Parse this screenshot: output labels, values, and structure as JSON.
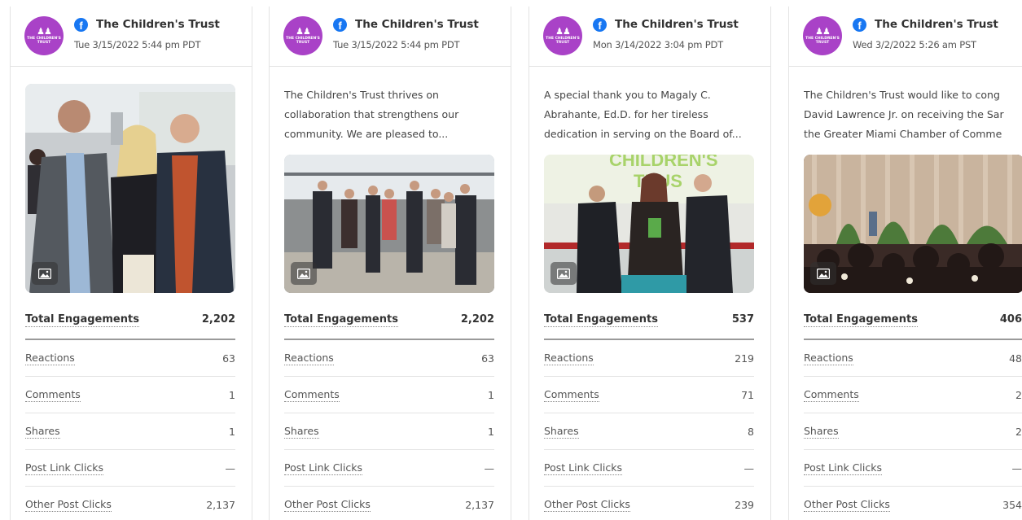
{
  "cards": [
    {
      "page_name": "The Children's Trust",
      "date": "Tue 3/15/2022 5:44 pm PDT",
      "text_lines": [],
      "metrics": {
        "total_label": "Total Engagements",
        "total_value": "2,202",
        "reactions_label": "Reactions",
        "reactions_value": "63",
        "comments_label": "Comments",
        "comments_value": "1",
        "shares_label": "Shares",
        "shares_value": "1",
        "link_clicks_label": "Post Link Clicks",
        "link_clicks_value": "—",
        "other_clicks_label": "Other Post Clicks",
        "other_clicks_value": "2,137"
      }
    },
    {
      "page_name": "The Children's Trust",
      "date": "Tue 3/15/2022 5:44 pm PDT",
      "text_lines": [
        "The Children's Trust thrives on",
        "collaboration that strengthens our",
        "community. We are pleased to..."
      ],
      "metrics": {
        "total_label": "Total Engagements",
        "total_value": "2,202",
        "reactions_label": "Reactions",
        "reactions_value": "63",
        "comments_label": "Comments",
        "comments_value": "1",
        "shares_label": "Shares",
        "shares_value": "1",
        "link_clicks_label": "Post Link Clicks",
        "link_clicks_value": "—",
        "other_clicks_label": "Other Post Clicks",
        "other_clicks_value": "2,137"
      }
    },
    {
      "page_name": "The Children's Trust",
      "date": "Mon 3/14/2022 3:04 pm PDT",
      "text_lines": [
        "A special thank you to Magaly C.",
        "Abrahante, Ed.D. for her tireless",
        "dedication in serving on the Board of..."
      ],
      "metrics": {
        "total_label": "Total Engagements",
        "total_value": "537",
        "reactions_label": "Reactions",
        "reactions_value": "219",
        "comments_label": "Comments",
        "comments_value": "71",
        "shares_label": "Shares",
        "shares_value": "8",
        "link_clicks_label": "Post Link Clicks",
        "link_clicks_value": "—",
        "other_clicks_label": "Other Post Clicks",
        "other_clicks_value": "239"
      }
    },
    {
      "page_name": "The Children's Trust",
      "date": "Wed 3/2/2022 5:26 am PST",
      "text_lines": [
        "The Children's Trust would like to cong",
        "David Lawrence Jr. on receiving the Sar",
        "the Greater Miami Chamber of Comme"
      ],
      "metrics": {
        "total_label": "Total Engagements",
        "total_value": "406",
        "reactions_label": "Reactions",
        "reactions_value": "48",
        "comments_label": "Comments",
        "comments_value": "2",
        "shares_label": "Shares",
        "shares_value": "2",
        "link_clicks_label": "Post Link Clicks",
        "link_clicks_value": "—",
        "other_clicks_label": "Other Post Clicks",
        "other_clicks_value": "354"
      }
    }
  ],
  "avatar": {
    "figures": "ⅢⅢ",
    "logo_text": "THE CHILDREN'S TRUST"
  },
  "colors": {
    "avatar": "#a942c7",
    "facebook": "#1877f2"
  },
  "icons": {
    "network": "facebook-icon",
    "media": "image-icon"
  }
}
